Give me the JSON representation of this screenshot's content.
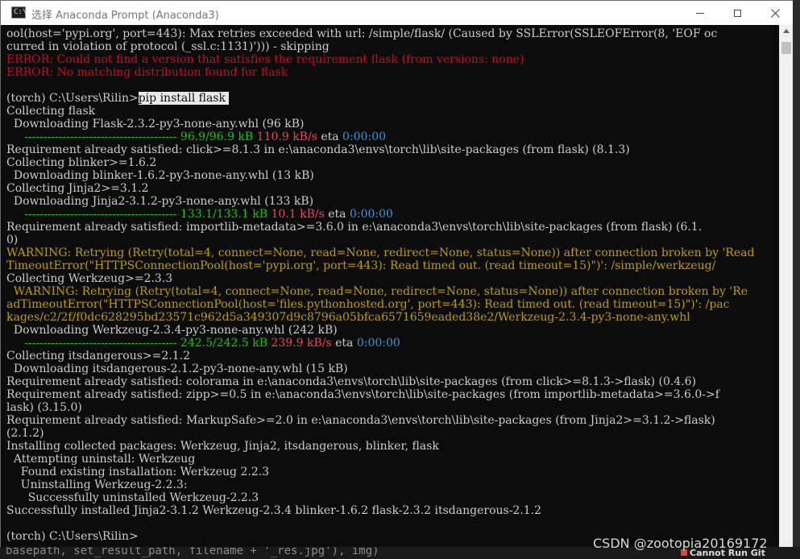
{
  "window": {
    "title": "选择 Anaconda Prompt (Anaconda3)",
    "icon_name": "terminal-icon",
    "buttons": {
      "minimize_icon": "minimize-icon",
      "maximize_icon": "maximize-icon",
      "close_icon": "close-icon"
    }
  },
  "console": {
    "l00": "ool(host='pypi.org', port=443): Max retries exceeded with url: /simple/flask/ (Caused by SSLError(SSLEOFError(8, 'EOF oc",
    "l01": "curred in violation of protocol (_ssl.c:1131)'))) - skipping",
    "l02": "ERROR: Could not find a version that satisfies the requirement flask (from versions: none)",
    "l03": "ERROR: No matching distribution found for flask",
    "l05_prompt": "(torch) C:\\Users\\Rilin>",
    "l05_cmd": "pip install flask ",
    "l06": "Collecting flask",
    "l07": "  Downloading Flask-2.3.2-py3-none-any.whl (96 kB)",
    "l08_bar": "     ---------------------------------------- ",
    "l08_size": "96.9/96.9 kB",
    "l08_speed": "110.9 kB/s",
    "l08_eta_label": " eta ",
    "l08_eta": "0:00:00",
    "l09": "Requirement already satisfied: click>=8.1.3 in e:\\anaconda3\\envs\\torch\\lib\\site-packages (from flask) (8.1.3)",
    "l10": "Collecting blinker>=1.6.2",
    "l11": "  Downloading blinker-1.6.2-py3-none-any.whl (13 kB)",
    "l12": "Collecting Jinja2>=3.1.2",
    "l13": "  Downloading Jinja2-3.1.2-py3-none-any.whl (133 kB)",
    "l14_bar": "     ---------------------------------------- ",
    "l14_size": "133.1/133.1 kB",
    "l14_speed": "10.1 kB/s",
    "l14_eta_label": " eta ",
    "l14_eta": "0:00:00",
    "l15": "Requirement already satisfied: importlib-metadata>=3.6.0 in e:\\anaconda3\\envs\\torch\\lib\\site-packages (from flask) (6.1.",
    "l16": "0)",
    "l17": "WARNING: Retrying (Retry(total=4, connect=None, read=None, redirect=None, status=None)) after connection broken by 'Read",
    "l18": "TimeoutError(\"HTTPSConnectionPool(host='pypi.org', port=443): Read timed out. (read timeout=15)\")': /simple/werkzeug/",
    "l19": "Collecting Werkzeug>=2.3.3",
    "l20": "  WARNING: Retrying (Retry(total=4, connect=None, read=None, redirect=None, status=None)) after connection broken by 'Re",
    "l21": "adTimeoutError(\"HTTPSConnectionPool(host='files.pythonhosted.org', port=443): Read timed out. (read timeout=15)\")': /pac",
    "l22": "kages/c2/2f/f0dc628295bd23571c962d5a349307d9c8796a05bfca6571659eaded38e2/Werkzeug-2.3.4-py3-none-any.whl",
    "l23": "  Downloading Werkzeug-2.3.4-py3-none-any.whl (242 kB)",
    "l24_bar": "     ---------------------------------------- ",
    "l24_size": "242.5/242.5 kB",
    "l24_speed": "239.9 kB/s",
    "l24_eta_label": " eta ",
    "l24_eta": "0:00:00",
    "l25": "Collecting itsdangerous>=2.1.2",
    "l26": "  Downloading itsdangerous-2.1.2-py3-none-any.whl (15 kB)",
    "l27": "Requirement already satisfied: colorama in e:\\anaconda3\\envs\\torch\\lib\\site-packages (from click>=8.1.3->flask) (0.4.6)",
    "l28": "Requirement already satisfied: zipp>=0.5 in e:\\anaconda3\\envs\\torch\\lib\\site-packages (from importlib-metadata>=3.6.0->f",
    "l29": "lask) (3.15.0)",
    "l30": "Requirement already satisfied: MarkupSafe>=2.0 in e:\\anaconda3\\envs\\torch\\lib\\site-packages (from Jinja2>=3.1.2->flask)",
    "l31": "(2.1.2)",
    "l32": "Installing collected packages: Werkzeug, Jinja2, itsdangerous, blinker, flask",
    "l33": "  Attempting uninstall: Werkzeug",
    "l34": "    Found existing installation: Werkzeug 2.2.3",
    "l35": "    Uninstalling Werkzeug-2.2.3:",
    "l36": "      Successfully uninstalled Werkzeug-2.2.3",
    "l37": "Successfully installed Jinja2-3.1.2 Werkzeug-2.3.4 blinker-1.6.2 flask-2.3.2 itsdangerous-2.1.2",
    "l39": "(torch) C:\\Users\\Rilin>"
  },
  "overlay": {
    "watermark": "CSDN @zootopia20169172",
    "background_text": "basepath, set_result_path, filename + '_res.jpg'), img)",
    "git_badge": "Cannot Run Git"
  },
  "colors": {
    "console_bg": "#0c0c0c",
    "console_fg": "#cccccc",
    "error": "#c50f1f",
    "warning": "#c19c00",
    "progress_green": "#16c60c",
    "speed_red": "#e74856",
    "eta_cyan": "#3a96dd"
  }
}
